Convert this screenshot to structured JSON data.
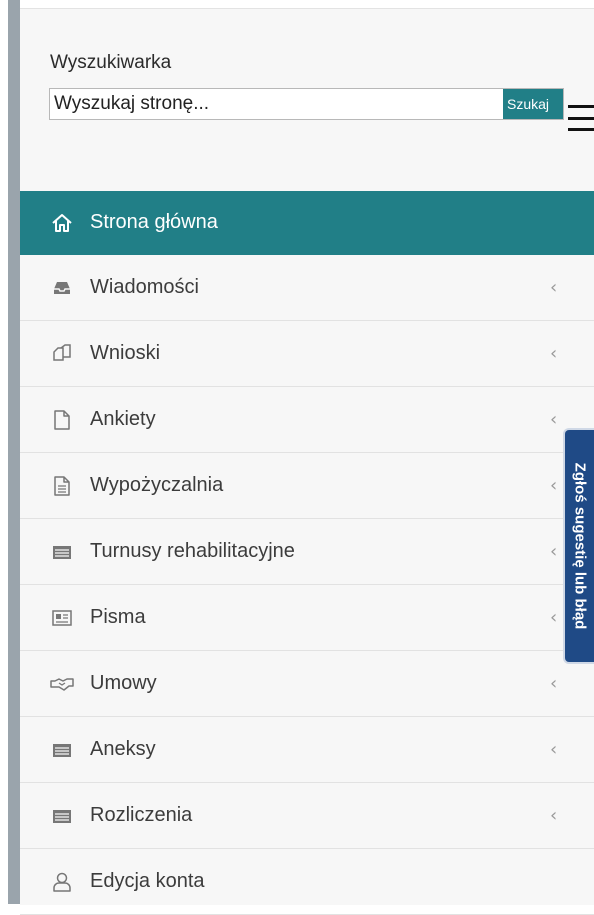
{
  "search": {
    "label": "Wyszukiwarka",
    "placeholder": "Wyszukaj stronę...",
    "button_label": "Szukaj"
  },
  "menu": {
    "items": [
      {
        "label": "Strona główna",
        "icon": "home-icon",
        "active": true,
        "has_chevron": false
      },
      {
        "label": "Wiadomości",
        "icon": "inbox-icon",
        "active": false,
        "has_chevron": true
      },
      {
        "label": "Wnioski",
        "icon": "copy-documents-icon",
        "active": false,
        "has_chevron": true
      },
      {
        "label": "Ankiety",
        "icon": "file-icon",
        "active": false,
        "has_chevron": true
      },
      {
        "label": "Wypożyczalnia",
        "icon": "file-text-icon",
        "active": false,
        "has_chevron": true
      },
      {
        "label": "Turnusy rehabilitacyjne",
        "icon": "list-card-icon",
        "active": false,
        "has_chevron": true
      },
      {
        "label": "Pisma",
        "icon": "newspaper-icon",
        "active": false,
        "has_chevron": true
      },
      {
        "label": "Umowy",
        "icon": "handshake-icon",
        "active": false,
        "has_chevron": true
      },
      {
        "label": "Aneksy",
        "icon": "list-card-icon",
        "active": false,
        "has_chevron": true
      },
      {
        "label": "Rozliczenia",
        "icon": "list-card-icon",
        "active": false,
        "has_chevron": true
      },
      {
        "label": "Edycja konta",
        "icon": "user-icon",
        "active": false,
        "has_chevron": false
      }
    ],
    "chevron_glyph": "‹"
  },
  "feedback_tab": {
    "label": "Zgłoś sugestię lub błąd"
  },
  "colors": {
    "accent": "#217f87",
    "feedback_tab": "#1f4a86",
    "sidebar_bg": "#f7f7f7"
  }
}
